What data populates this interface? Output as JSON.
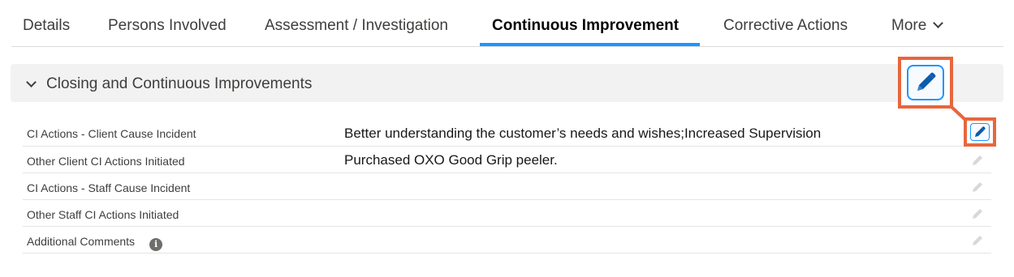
{
  "tabs": [
    {
      "label": "Details"
    },
    {
      "label": "Persons Involved"
    },
    {
      "label": "Assessment / Investigation"
    },
    {
      "label": "Continuous Improvement"
    },
    {
      "label": "Corrective Actions"
    },
    {
      "label": "More"
    }
  ],
  "active_tab": "Continuous Improvement",
  "section": {
    "title": "Closing and Continuous Improvements"
  },
  "fields": [
    {
      "label": "CI Actions - Client Cause Incident",
      "value": "Better understanding the customer’s needs and wishes;Increased Supervision"
    },
    {
      "label": "Other Client CI Actions Initiated",
      "value": "Purchased OXO Good Grip peeler."
    },
    {
      "label": "CI Actions - Staff Cause Incident",
      "value": ""
    },
    {
      "label": "Other Staff CI Actions Initiated",
      "value": ""
    },
    {
      "label": "Additional Comments",
      "value": ""
    }
  ],
  "info_icon": "info-icon",
  "edit_icon": "pencil-icon",
  "colors": {
    "accent": "#1b96ff",
    "highlight": "#e8663c",
    "section_bg": "#f3f2f2"
  }
}
